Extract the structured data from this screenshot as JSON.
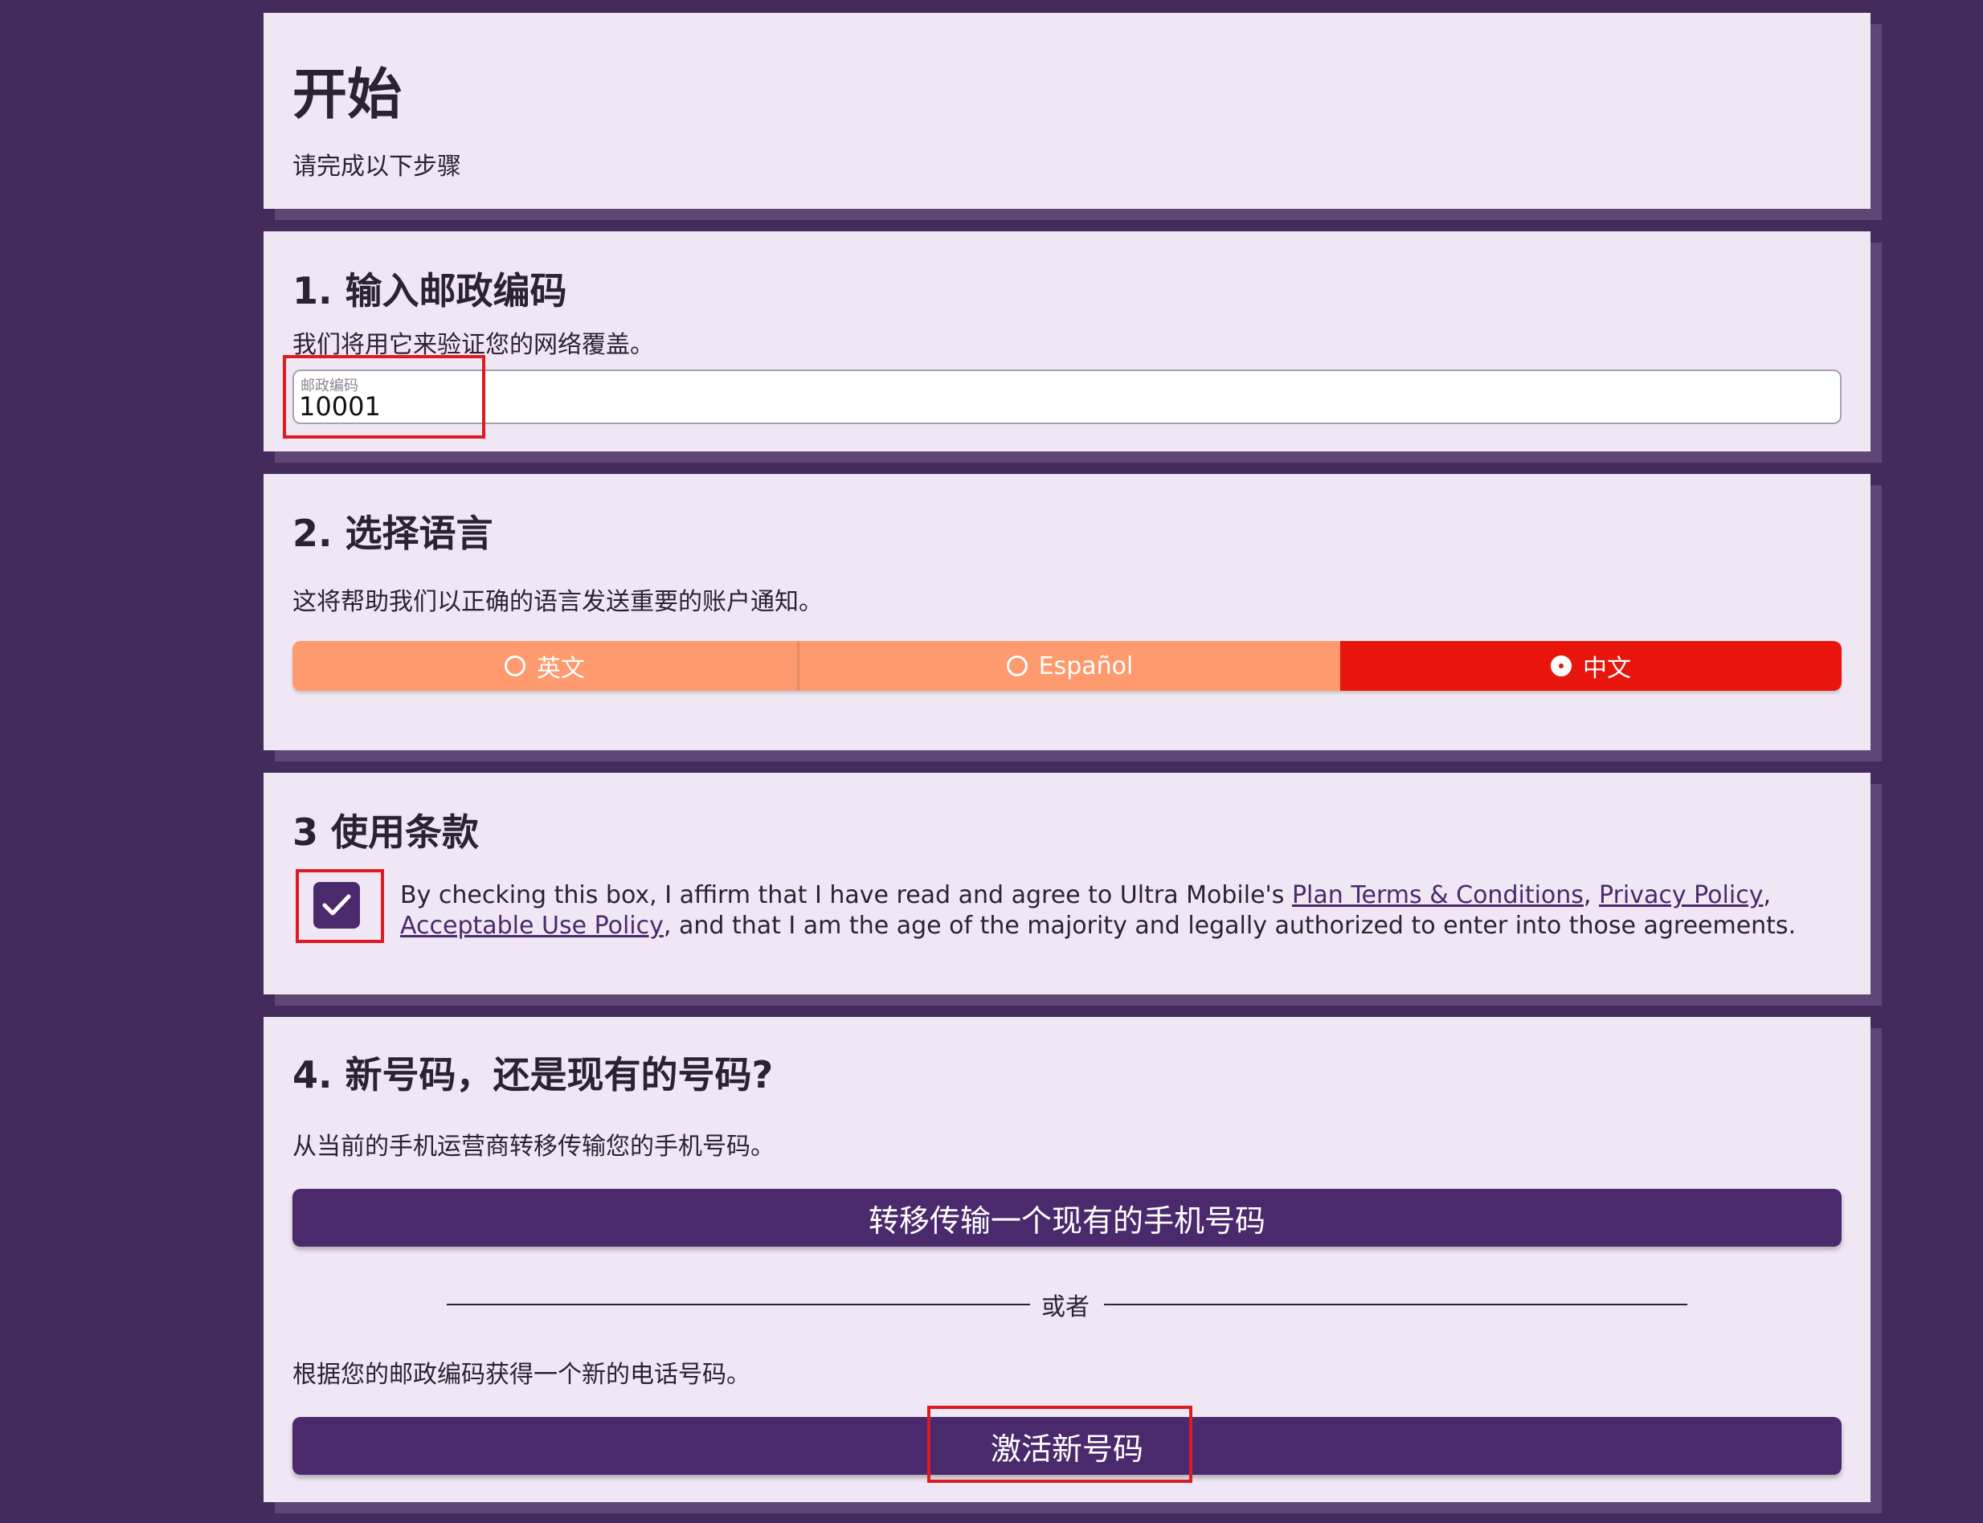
{
  "intro": {
    "title": "开始",
    "subtitle": "请完成以下步骤"
  },
  "step1": {
    "title": "1. 输入邮政编码",
    "description": "我们将用它来验证您的网络覆盖。",
    "zip_label": "邮政编码",
    "zip_value": "10001"
  },
  "step2": {
    "title": "2. 选择语言",
    "description": "这将帮助我们以正确的语言发送重要的账户通知。",
    "options": [
      {
        "label": "英文",
        "selected": false
      },
      {
        "label": "Español",
        "selected": false
      },
      {
        "label": "中文",
        "selected": true
      }
    ]
  },
  "step3": {
    "title": "3 使用条款",
    "checked": true,
    "text_before": "By checking this box, I affirm that I have read and agree to Ultra Mobile's ",
    "link_plan_terms": "Plan Terms & Conditions",
    "sep1": ", ",
    "link_privacy": "Privacy Policy",
    "sep2": ", ",
    "link_aup": "Acceptable Use Policy",
    "text_after": ", and that I am the age of the majority and legally authorized to enter into those agreements."
  },
  "step4": {
    "title": "4. 新号码，还是现有的号码?",
    "transfer_description": "从当前的手机运营商转移传输您的手机号码。",
    "transfer_button": "转移传输一个现有的手机号码",
    "or_label": "或者",
    "new_description": "根据您的邮政编码获得一个新的电话号码。",
    "activate_button": "激活新号码"
  },
  "colors": {
    "background": "#432b5b",
    "card": "#efe7f3",
    "primary": "#4a2a6c",
    "segment": "#ff9a6f",
    "segment_active": "#e8150c",
    "highlight": "#e01a22"
  },
  "icons": {
    "checkbox": "check-icon",
    "radio": "radio-icon"
  }
}
